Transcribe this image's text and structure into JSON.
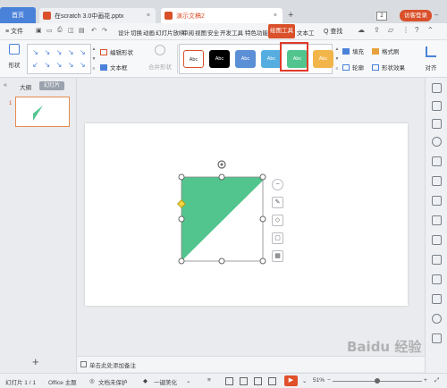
{
  "tabs": {
    "home": "首页",
    "file_tab": "在scratch 3.0中画花.pptx",
    "active_tab": "演示文稿2",
    "new_tab": "+",
    "tab_count": "2",
    "login": "访客登录"
  },
  "menubar": {
    "file": "≡ 文件",
    "items": [
      "设计",
      "切换",
      "动画",
      "幻灯片放映",
      "审阅",
      "视图",
      "安全",
      "开发工具",
      "特色功能",
      "文本工"
    ],
    "draw_tools": "绘图工具",
    "search": "Q 查找"
  },
  "ribbon": {
    "shape": "形状",
    "connectors": [
      "↘",
      "↘",
      "↘",
      "↘",
      "↘",
      "↙",
      "↘",
      "↘",
      "↘",
      "↘"
    ],
    "edit_shape": "编辑形状",
    "text_box": "文本框",
    "merge_shape": "合并形状",
    "style_label": "Abc",
    "styles": [
      "Abc",
      "Abc",
      "Abc",
      "Abc",
      "Abc",
      "Abc"
    ],
    "fill": "填充",
    "outline": "轮廓",
    "format_brush": "格式刷",
    "shape_effects": "形状效果",
    "align": "对齐"
  },
  "leftpanel": {
    "collapse": "«",
    "outline_tab": "大纲",
    "slides_tab": "幻灯片",
    "slide_number": "1",
    "add": "+"
  },
  "notes": {
    "placeholder": "单击此处添加备注"
  },
  "statusbar": {
    "slide_info": "幻灯片 1 / 1",
    "theme": "Office 主题",
    "doc_status": "文档未保护",
    "beautify": "一键美化",
    "zoom": "51%",
    "zoom_level": 0.51
  },
  "colors": {
    "accent": "#d9502a",
    "shape_fill": "#52c58e",
    "highlight": "#e03a2a"
  },
  "watermark": "Baidu 经验"
}
